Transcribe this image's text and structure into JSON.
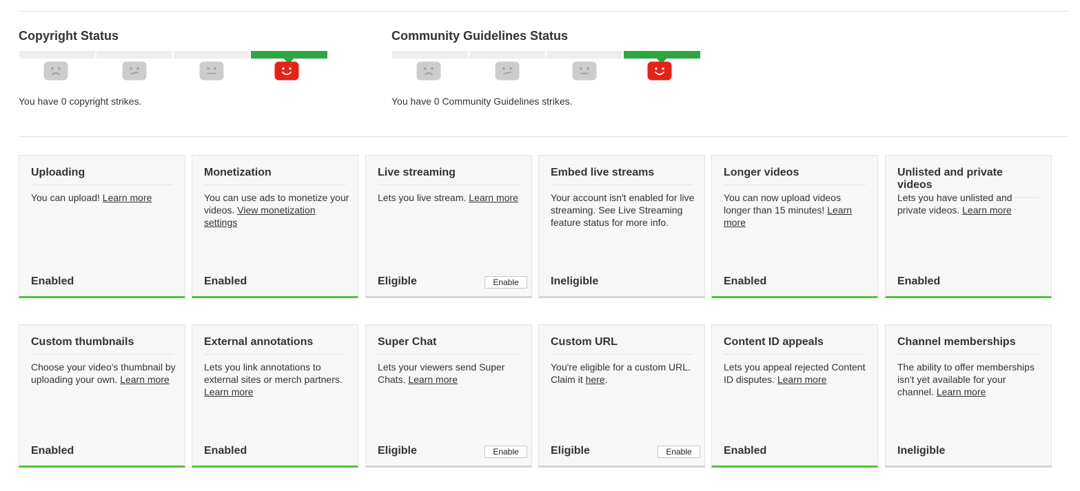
{
  "colors": {
    "strike_active": "#2ba640",
    "strike_inactive": "#eeeeee",
    "face_inactive": "#cccccc",
    "face_active": "#e62117",
    "card_enabled_border": "#4cc734",
    "card_other_border": "#d4d4d4",
    "card_background": "#f7f7f7"
  },
  "copyright": {
    "title": "Copyright Status",
    "text": "You have 0 copyright strikes.",
    "strikes": 0,
    "faces": [
      "sad-face-icon",
      "uneasy-face-icon",
      "neutral-face-icon",
      "happy-face-icon"
    ]
  },
  "community": {
    "title": "Community Guidelines Status",
    "text": "You have 0 Community Guidelines strikes.",
    "strikes": 0,
    "faces": [
      "sad-face-icon",
      "uneasy-face-icon",
      "neutral-face-icon",
      "happy-face-icon"
    ]
  },
  "features": [
    {
      "title": "Uploading",
      "desc": [
        {
          "t": "You can upload! "
        },
        {
          "t": "Learn more",
          "link": true
        }
      ],
      "status": "Enabled",
      "enabled": true
    },
    {
      "title": "Monetization",
      "desc": [
        {
          "t": "You can use ads to monetize your videos. "
        },
        {
          "t": "View monetization settings",
          "link": true
        }
      ],
      "status": "Enabled",
      "enabled": true
    },
    {
      "title": "Live streaming",
      "desc": [
        {
          "t": "Lets you live stream. "
        },
        {
          "t": "Learn more",
          "link": true
        }
      ],
      "status": "Eligible",
      "enabled": false,
      "button": "Enable"
    },
    {
      "title": "Embed live streams",
      "desc": [
        {
          "t": "Your account isn't enabled for live streaming. See Live Streaming feature status for more info."
        }
      ],
      "status": "Ineligible",
      "enabled": false
    },
    {
      "title": "Longer videos",
      "desc": [
        {
          "t": "You can now upload videos longer than 15 minutes! "
        },
        {
          "t": "Learn more",
          "link": true
        }
      ],
      "status": "Enabled",
      "enabled": true
    },
    {
      "title": "Unlisted and private videos",
      "desc": [
        {
          "t": "Lets you have unlisted and private videos. "
        },
        {
          "t": "Learn more",
          "link": true
        }
      ],
      "status": "Enabled",
      "enabled": true
    },
    {
      "title": "Custom thumbnails",
      "desc": [
        {
          "t": "Choose your video's thumbnail by uploading your own. "
        },
        {
          "t": "Learn more",
          "link": true
        }
      ],
      "status": "Enabled",
      "enabled": true
    },
    {
      "title": "External annotations",
      "desc": [
        {
          "t": "Lets you link annotations to external sites or merch partners. "
        },
        {
          "t": "Learn more",
          "link": true
        }
      ],
      "status": "Enabled",
      "enabled": true
    },
    {
      "title": "Super Chat",
      "desc": [
        {
          "t": "Lets your viewers send Super Chats. "
        },
        {
          "t": "Learn more",
          "link": true
        }
      ],
      "status": "Eligible",
      "enabled": false,
      "button": "Enable"
    },
    {
      "title": "Custom URL",
      "desc": [
        {
          "t": "You're eligible for a custom URL. Claim it "
        },
        {
          "t": "here",
          "link": true
        },
        {
          "t": "."
        }
      ],
      "status": "Eligible",
      "enabled": false,
      "button": "Enable"
    },
    {
      "title": "Content ID appeals",
      "desc": [
        {
          "t": "Lets you appeal rejected Content ID disputes. "
        },
        {
          "t": "Learn more",
          "link": true
        }
      ],
      "status": "Enabled",
      "enabled": true
    },
    {
      "title": "Channel memberships",
      "desc": [
        {
          "t": "The ability to offer memberships isn't yet available for your channel. "
        },
        {
          "t": "Learn more",
          "link": true
        }
      ],
      "status": "Ineligible",
      "enabled": false
    }
  ]
}
